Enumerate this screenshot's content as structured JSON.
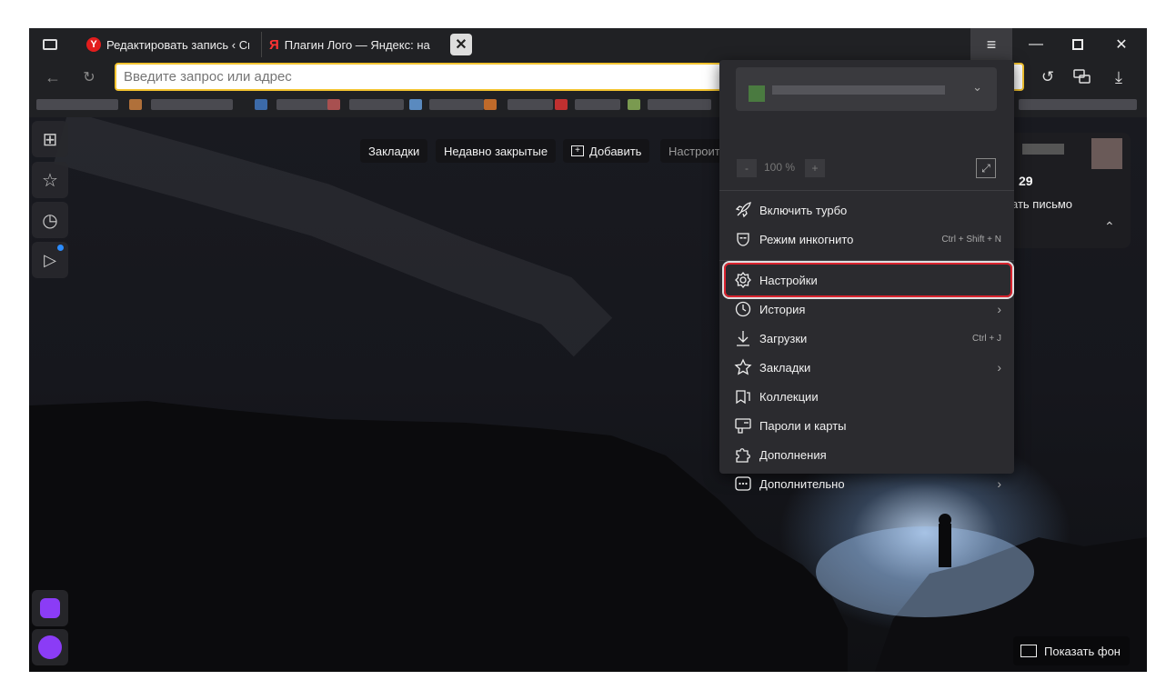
{
  "tabs": [
    {
      "title": "Редактировать запись ‹ Ск",
      "icon": "yandex-browser-icon"
    },
    {
      "title": "Плагин Лого — Яндекс: на",
      "icon": "yandex-icon"
    }
  ],
  "address_placeholder": "Введите запрос или адрес",
  "newtab_buttons": {
    "bookmarks": "Закладки",
    "recently_closed": "Недавно закрытые",
    "add": "Добавить",
    "customize": "Настроить"
  },
  "mail_widget": {
    "count": "29",
    "action": "ать письмо"
  },
  "menu": {
    "zoom": "100 %",
    "zoom_minus": "-",
    "zoom_plus": "+",
    "items": [
      {
        "label": "Включить турбо",
        "icon": "rocket-icon"
      },
      {
        "label": "Режим инкогнито",
        "icon": "incognito-mask-icon",
        "shortcut": "Ctrl + Shift + N"
      },
      {
        "label": "Настройки",
        "icon": "gear-icon",
        "highlighted": true
      },
      {
        "label": "История",
        "icon": "clock-icon",
        "submenu": true
      },
      {
        "label": "Загрузки",
        "icon": "download-icon",
        "shortcut": "Ctrl + J"
      },
      {
        "label": "Закладки",
        "icon": "star-icon",
        "submenu": true
      },
      {
        "label": "Коллекции",
        "icon": "collections-icon"
      },
      {
        "label": "Пароли и карты",
        "icon": "key-card-icon"
      },
      {
        "label": "Дополнения",
        "icon": "puzzle-icon"
      },
      {
        "label": "Дополнительно",
        "icon": "more-dots-icon",
        "submenu": true
      }
    ]
  },
  "show_background": "Показать фон",
  "colors": {
    "accent_yellow": "#f4c430",
    "highlight_red": "#d9232e",
    "menu_bg": "#2b2b2f",
    "alice_purple": "#8b3cf6"
  }
}
